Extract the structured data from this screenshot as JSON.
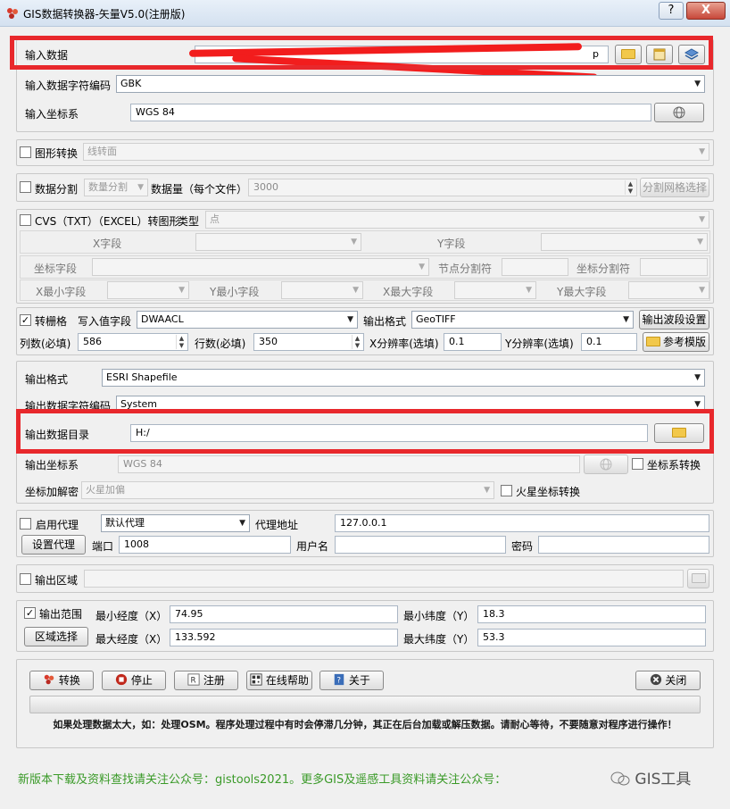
{
  "window": {
    "title": "GIS数据转换器-矢量V5.0(注册版)",
    "help_btn": "?",
    "close_btn": "X"
  },
  "input": {
    "data_label": "输入数据",
    "data_value_tail": "p",
    "encoding_label": "输入数据字符编码",
    "encoding_value": "GBK",
    "crs_label": "输入坐标系",
    "crs_value": "WGS 84"
  },
  "shape_convert": {
    "label": "图形转换",
    "checked": false,
    "mode": "线转面"
  },
  "split": {
    "label": "数据分割",
    "checked": false,
    "mode": "数量分割",
    "count_label": "数据量（每个文件）",
    "count_value": "3000",
    "grid_button": "分割网格选择"
  },
  "csv": {
    "label": "CVS（TXT）（EXCEL）转图形",
    "checked": false,
    "type_label": "类型",
    "type_value": "点",
    "x_field": "X字段",
    "y_field": "Y字段",
    "coord_field": "坐标字段",
    "node_sep": "节点分割符",
    "coord_sep": "坐标分割符",
    "xmin_field": "X最小字段",
    "ymin_field": "Y最小字段",
    "xmax_field": "X最大字段",
    "ymax_field": "Y最大字段"
  },
  "raster": {
    "label": "转栅格",
    "checked": true,
    "write_field_label": "写入值字段",
    "write_field_value": "DWAACL",
    "format_label": "输出格式",
    "format_value": "GeoTIFF",
    "band_button": "输出波段设置",
    "cols_label": "列数(必填)",
    "cols_value": "586",
    "rows_label": "行数(必填)",
    "rows_value": "350",
    "xres_label": "X分辨率(选填)",
    "xres_value": "0.1",
    "yres_label": "Y分辨率(选填)",
    "yres_value": "0.1",
    "template_button": "参考模版"
  },
  "output": {
    "format_label": "输出格式",
    "format_value": "ESRI Shapefile",
    "encoding_label": "输出数据字符编码",
    "encoding_value": "System",
    "dir_label": "输出数据目录",
    "dir_value": "H:/",
    "crs_label": "输出坐标系",
    "crs_value": "WGS 84",
    "crs_convert_label": "坐标系转换",
    "encrypt_label": "坐标加解密",
    "encrypt_value": "火星加偏",
    "mars_label": "火星坐标转换"
  },
  "proxy": {
    "enable_label": "启用代理",
    "mode_value": "默认代理",
    "address_label": "代理地址",
    "address_value": "127.0.0.1",
    "set_button": "设置代理",
    "port_label": "端口",
    "port_value": "1008",
    "user_label": "用户名",
    "user_value": "",
    "password_label": "密码",
    "password_value": ""
  },
  "region": {
    "label": "输出区域",
    "value": ""
  },
  "extent": {
    "label": "输出范围",
    "checked": true,
    "select_button": "区域选择",
    "min_lon_label": "最小经度（X）",
    "min_lon_value": "74.95",
    "min_lat_label": "最小纬度（Y）",
    "min_lat_value": "18.3",
    "max_lon_label": "最大经度（X）",
    "max_lon_value": "133.592",
    "max_lat_label": "最大纬度（Y）",
    "max_lat_value": "53.3"
  },
  "actions": {
    "convert": "转换",
    "stop": "停止",
    "register": "注册",
    "help": "在线帮助",
    "about": "关于",
    "close": "关闭"
  },
  "notice": "如果处理数据太大，如：处理OSM。程序处理过程中有时会停滞几分钟，其正在后台加载或解压数据。请耐心等待，不要随意对程序进行操作！",
  "footer": {
    "text": "新版本下载及资料查找请关注公众号：gistools2021。更多GIS及遥感工具资料请关注公众号：",
    "watermark": "GIS工具"
  },
  "colors": {
    "highlight": "#e8282c",
    "footer_text": "#3a9a28"
  }
}
